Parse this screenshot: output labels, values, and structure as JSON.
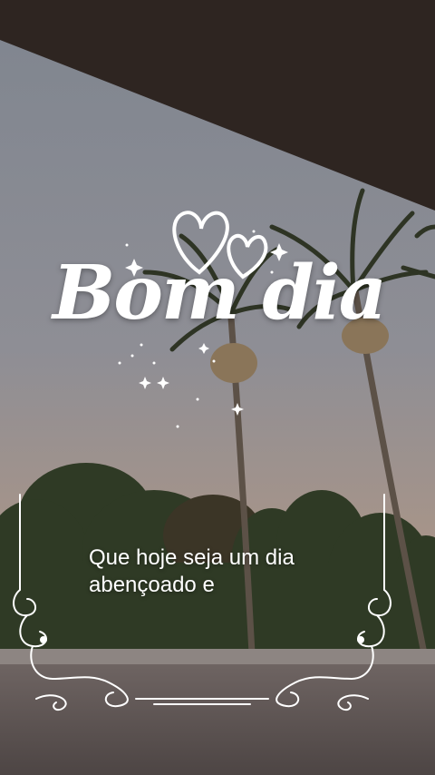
{
  "greeting": {
    "title": "Bom dia",
    "message_line1": "Que hoje seja um dia",
    "message_line2": "abençoado e"
  },
  "decorations": {
    "hearts_icon": "double-heart-icon",
    "sparkles_icon": "sparkle-stars-icon",
    "frame_icon": "ornamental-swirl-frame-icon"
  },
  "colors": {
    "sky_top": "#8b9099",
    "sky_bottom": "#b79a8a",
    "roof": "#2c2421",
    "text": "#ffffff"
  }
}
